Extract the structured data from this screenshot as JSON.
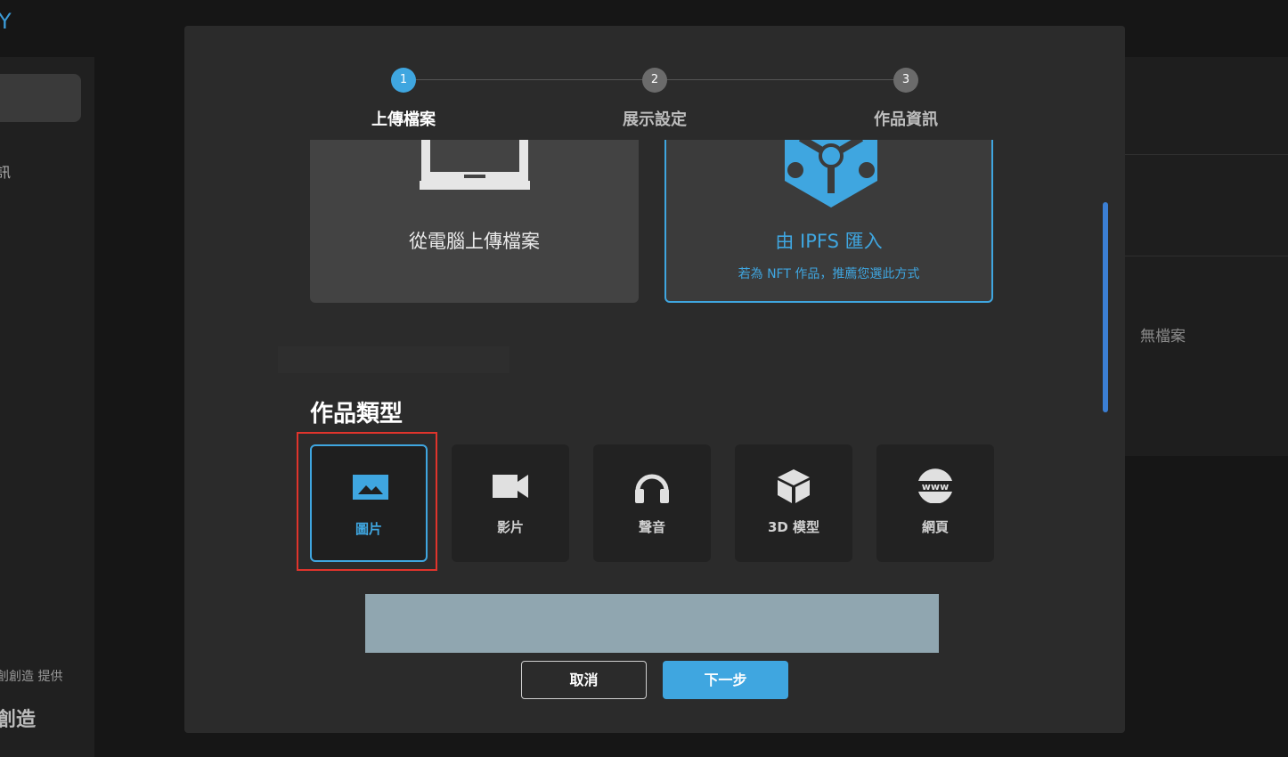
{
  "background": {
    "logo_fragment": "Y",
    "sidebar_fragment": "訊",
    "credit_text": "創創造 提供",
    "brand_text": "創造",
    "panel_status": "無檔案"
  },
  "modal": {
    "close_symbol": "✕",
    "steps": [
      {
        "number": "1",
        "label": "上傳檔案",
        "state": "active"
      },
      {
        "number": "2",
        "label": "展示設定",
        "state": "idle"
      },
      {
        "number": "3",
        "label": "作品資訊",
        "state": "idle"
      }
    ],
    "upload_options": {
      "pc": {
        "title": "從電腦上傳檔案",
        "icon": "laptop-icon"
      },
      "ipfs": {
        "title": "由 IPFS 匯入",
        "subtitle": "若為 NFT 作品，推薦您選此方式",
        "icon": "ipfs-cube-icon"
      }
    },
    "section_title": "作品類型",
    "work_types": [
      {
        "label": "圖片",
        "icon": "image-icon",
        "selected": true
      },
      {
        "label": "影片",
        "icon": "video-camera-icon",
        "selected": false
      },
      {
        "label": "聲音",
        "icon": "headphones-icon",
        "selected": false
      },
      {
        "label": "3D 模型",
        "icon": "cube-icon",
        "selected": false
      },
      {
        "label": "網頁",
        "icon": "www-globe-icon",
        "selected": false
      }
    ],
    "buttons": {
      "cancel": "取消",
      "next": "下一步"
    }
  },
  "colors": {
    "accent": "#3fa6e0",
    "highlight": "#e0342c",
    "modal_bg": "#2b2b2b"
  }
}
